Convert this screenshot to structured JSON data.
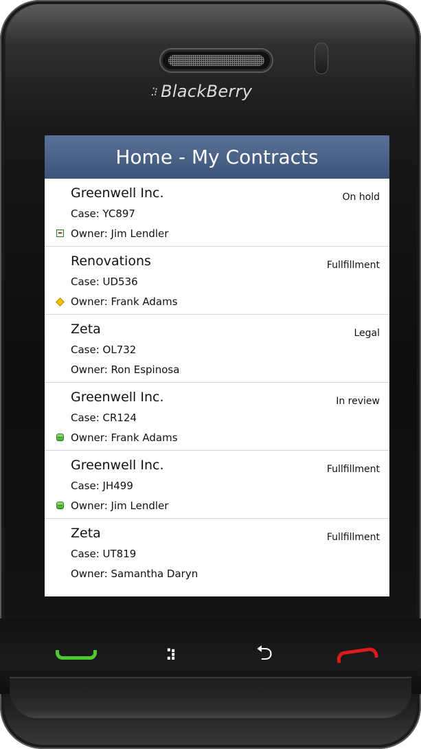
{
  "device": {
    "brand": "BlackBerry"
  },
  "screen": {
    "title": "Home - My Contracts",
    "contracts": [
      {
        "name": "Greenwell Inc.",
        "case": "Case: YC897",
        "owner": "Owner: Jim Lendler",
        "status": "On hold",
        "flag": "calendar-icon"
      },
      {
        "name": "Renovations",
        "case": "Case: UD536",
        "owner": "Owner: Frank Adams",
        "status": "Fullfillment",
        "flag": "yellow-diamond-icon"
      },
      {
        "name": "Zeta",
        "case": "Case: OL732",
        "owner": "Owner: Ron Espinosa",
        "status": "Legal",
        "flag": ""
      },
      {
        "name": "Greenwell Inc.",
        "case": "Case: CR124",
        "owner": "Owner: Frank Adams",
        "status": "In review",
        "flag": "green-status-icon"
      },
      {
        "name": "Greenwell Inc.",
        "case": "Case: JH499",
        "owner": "Owner: Jim Lendler",
        "status": "Fullfillment",
        "flag": "green-status-icon"
      },
      {
        "name": "Zeta",
        "case": "Case: UT819",
        "owner": "Owner: Samantha Daryn",
        "status": "Fullfillment",
        "flag": ""
      }
    ]
  },
  "keys": {
    "call": "call-key-icon",
    "menu": "blackberry-menu-key-icon",
    "back": "back-arrow-key-icon",
    "end": "end-call-key-icon"
  },
  "colors": {
    "titlebar": "#4a6186",
    "call_green": "#4ccb2e",
    "end_red": "#e0191c"
  }
}
